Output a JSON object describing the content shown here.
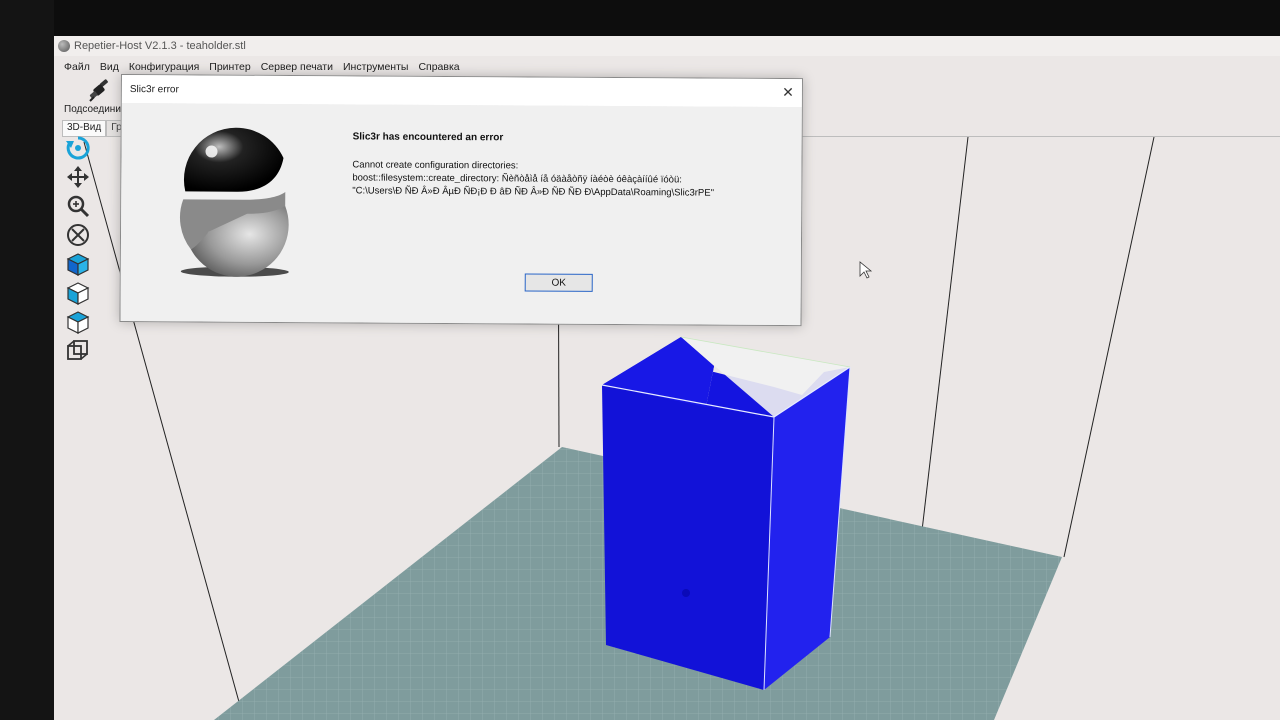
{
  "window": {
    "title": "Repetier-Host V2.1.3 - teaholder.stl"
  },
  "menu": [
    "Файл",
    "Вид",
    "Конфигурация",
    "Принтер",
    "Сервер печати",
    "Инструменты",
    "Справка"
  ],
  "toolbar": {
    "connect_label": "Подсоедини"
  },
  "tabs": [
    {
      "label": "3D-Вид"
    },
    {
      "label": "Граф"
    }
  ],
  "left_tools": [
    "rotate-icon",
    "move-icon",
    "zoom-icon",
    "fit-icon",
    "view-iso-icon",
    "view-front-icon",
    "view-top-icon",
    "wireframe-icon"
  ],
  "dialog": {
    "title": "Slic3r error",
    "heading": "Slic3r has encountered an error",
    "lines": [
      "Cannot create configuration directories:",
      "boost::filesystem::create_directory: Ñèñòåìå íå óäàåòñÿ íàéòè óêàçàííûé ïóòü:",
      "\"C:\\Users\\Đ ÑĐ Â»Đ ÂµĐ ÑĐ¡Đ Đ âĐ ÑĐ Â»Đ ÑĐ ÑĐ Đ\\AppData\\Roaming\\Slic3rPE\""
    ],
    "ok_label": "OK"
  },
  "colors": {
    "model": "#1414e0",
    "bed": "#7f9c9d",
    "background": "#ebe7e6",
    "accent": "#2a66c8"
  }
}
